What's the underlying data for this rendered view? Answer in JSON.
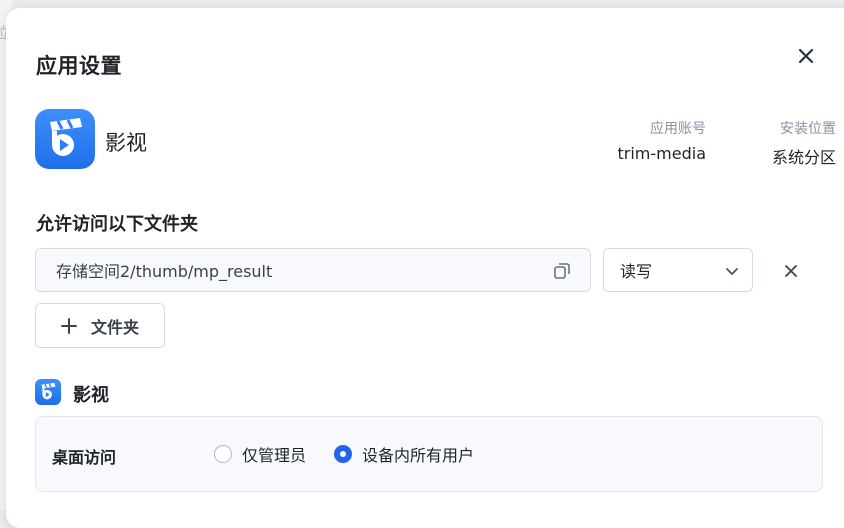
{
  "background": {
    "edge_glyph": "位"
  },
  "dialog": {
    "title": "应用设置",
    "close_icon": "close-icon"
  },
  "app": {
    "name": "影视",
    "icon": "film-clapper-icon",
    "icon_color": "#2f80f8",
    "account_label": "应用账号",
    "account_value": "trim-media",
    "location_label": "安装位置",
    "location_value": "系统分区"
  },
  "folders": {
    "section_title": "允许访问以下文件夹",
    "items": [
      {
        "path": "存储空间2/thumb/mp_result",
        "permission": "读写"
      }
    ],
    "add_button_label": "文件夹"
  },
  "desktop": {
    "section_title": "影视",
    "access_label": "桌面访问",
    "options": [
      {
        "label": "仅管理员",
        "checked": false
      },
      {
        "label": "设备内所有用户",
        "checked": true
      }
    ]
  },
  "colors": {
    "accent": "#2563eb",
    "text": "#1f2329",
    "muted": "#8a93a3"
  }
}
